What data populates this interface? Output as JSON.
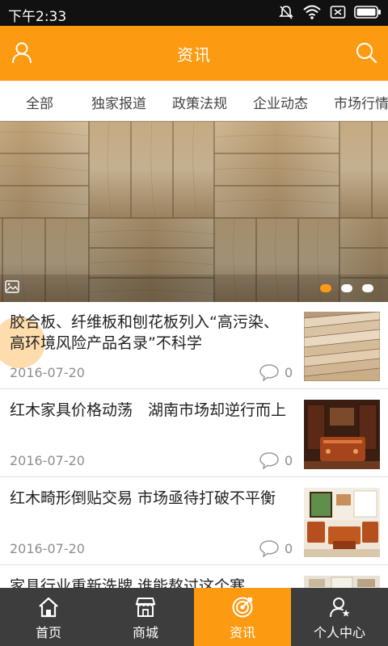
{
  "status_bar": {
    "time": "下午2:33",
    "icons": [
      "mute-icon",
      "wifi-icon",
      "sim-icon",
      "battery-icon"
    ]
  },
  "header": {
    "title": "资讯",
    "left_icon": "user-icon",
    "right_icon": "search-icon",
    "accent_color": "#fc9a12"
  },
  "category_tabs": [
    {
      "label": "全部"
    },
    {
      "label": "独家报道"
    },
    {
      "label": "政策法规"
    },
    {
      "label": "企业动态"
    },
    {
      "label": "市场行情"
    }
  ],
  "banner": {
    "image": "wood-parquet-floor",
    "slide_count": 3,
    "active_slide": 1
  },
  "news": [
    {
      "title": "胶合板、纤维板和刨花板列入“高污染、高环境风险产品名录”不科学",
      "date": "2016-07-20",
      "comments": "0",
      "thumbnail": "plywood-boards"
    },
    {
      "title": "红木家具价格动荡　湖南市场却逆行而上",
      "date": "2016-07-20",
      "comments": "0",
      "thumbnail": "rosewood-furniture-room"
    },
    {
      "title": "红木畸形倒贴交易 市场亟待打破不平衡",
      "date": "2016-07-20",
      "comments": "0",
      "thumbnail": "rosewood-sofa-set"
    },
    {
      "title": "家具行业重新洗牌 谁能熬过这个寒",
      "date": "",
      "comments": "",
      "thumbnail": "furniture-showroom"
    }
  ],
  "tabbar": [
    {
      "label": "首页",
      "icon": "home-icon",
      "active": false
    },
    {
      "label": "商城",
      "icon": "shop-icon",
      "active": false
    },
    {
      "label": "资讯",
      "icon": "target-icon",
      "active": true
    },
    {
      "label": "个人中心",
      "icon": "user-star-icon",
      "active": false
    }
  ]
}
